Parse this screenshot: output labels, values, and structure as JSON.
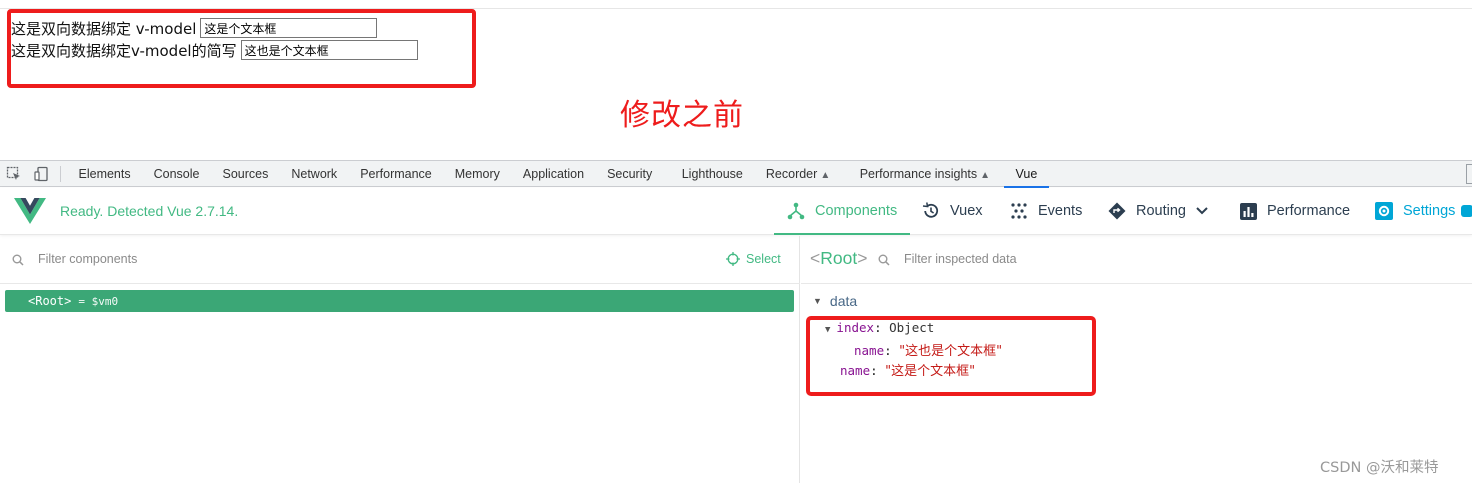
{
  "page": {
    "row1_label": "这是双向数据绑定 v-model",
    "row1_input_value": "这是个文本框",
    "row2_label": "这是双向数据绑定v-model的简写",
    "row2_input_value": "这也是个文本框",
    "annotation": "修改之前",
    "highlight_color": "#ee1c1c"
  },
  "devtools": {
    "tabs": [
      "Elements",
      "Console",
      "Sources",
      "Network",
      "Performance",
      "Memory",
      "Application",
      "Security",
      "Lighthouse",
      "Recorder",
      "Performance insights",
      "Vue"
    ],
    "active_tab": "Vue",
    "icons": [
      "inspect-element-icon",
      "device-toolbar-icon",
      "flask-icon"
    ]
  },
  "vue": {
    "status": "Ready. Detected Vue 2.7.14.",
    "accent_color": "#42b983",
    "nav": {
      "components": "Components",
      "vuex": "Vuex",
      "events": "Events",
      "routing": "Routing",
      "performance": "Performance",
      "settings": "Settings"
    },
    "components_pane": {
      "filter_placeholder": "Filter components",
      "select_label": "Select",
      "root_label": "<Root>",
      "root_ref": "= $vm0"
    },
    "inspector": {
      "title_open": "<",
      "title_name": "Root",
      "title_close": ">",
      "filter_placeholder": "Filter inspected data",
      "section": "data",
      "index_key": "index",
      "index_value": "Object",
      "nested_name_key": "name",
      "nested_name_value": "\"这也是个文本框\"",
      "name_key": "name",
      "name_value": "\"这是个文本框\""
    }
  },
  "watermark": "CSDN @沃和莱特"
}
